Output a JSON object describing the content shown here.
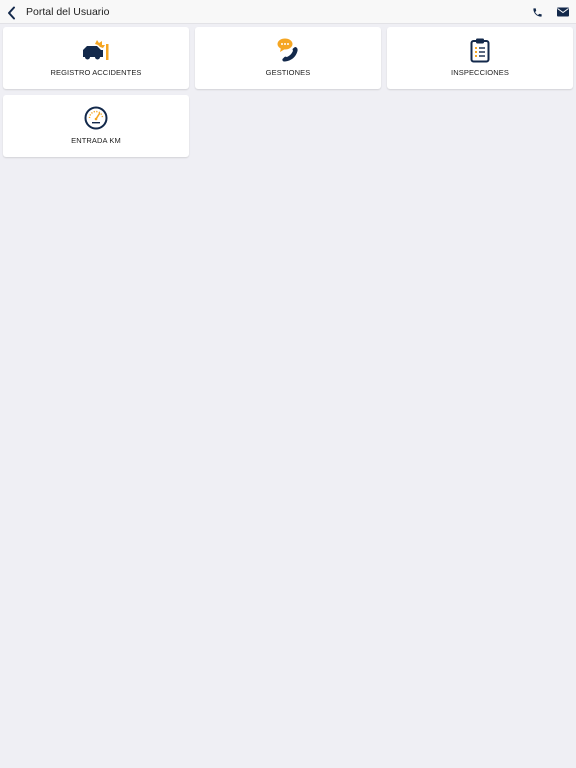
{
  "header": {
    "title": "Portal del Usuario",
    "back_icon": "chevron-left-icon",
    "actions": [
      {
        "icon": "phone-icon"
      },
      {
        "icon": "envelope-icon"
      }
    ]
  },
  "colors": {
    "navy": "#13294b",
    "accent": "#f5a623",
    "background": "#efeff4"
  },
  "tiles": [
    {
      "label": "REGISTRO ACCIDENTES",
      "icon": "car-crash-icon"
    },
    {
      "label": "GESTIONES",
      "icon": "phone-chat-icon"
    },
    {
      "label": "INSPECCIONES",
      "icon": "clipboard-checklist-icon"
    },
    {
      "label": "ENTRADA KM",
      "icon": "speedometer-icon"
    }
  ]
}
